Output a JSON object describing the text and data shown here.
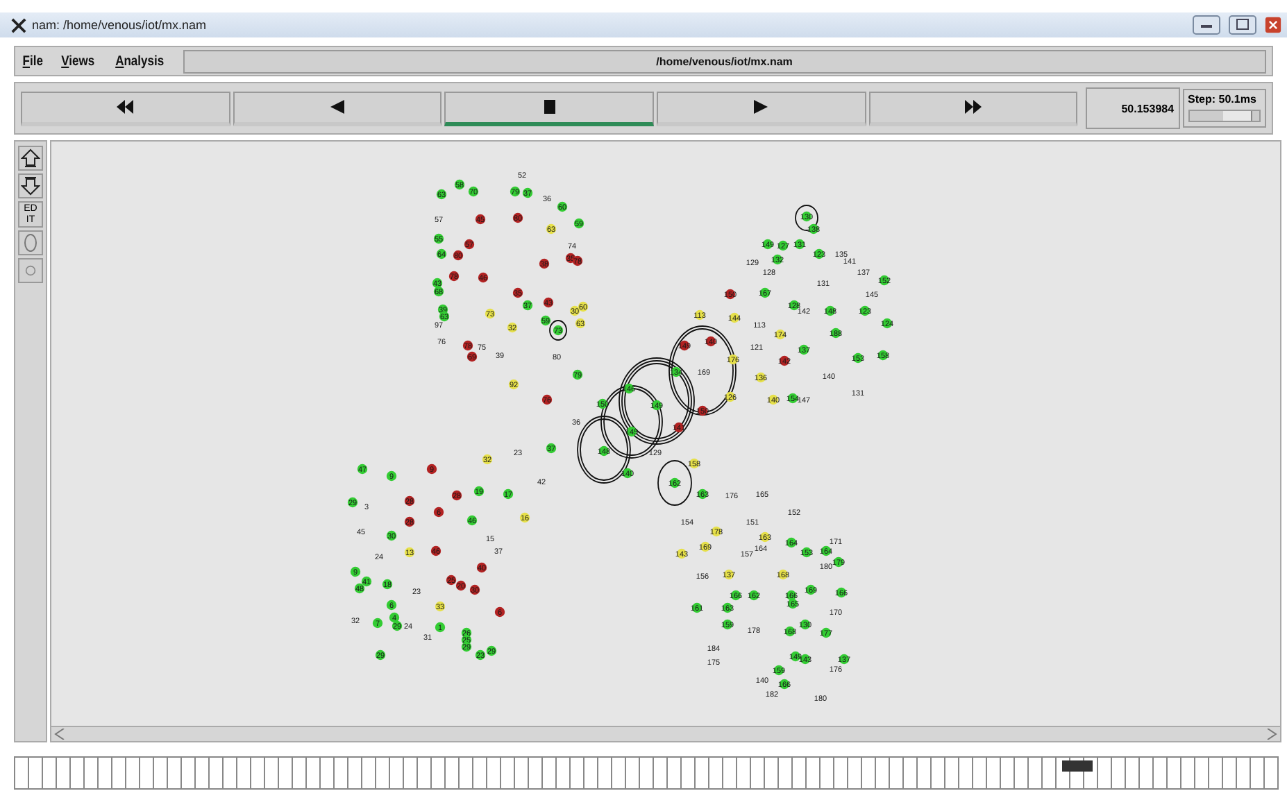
{
  "window": {
    "title": "nam: /home/venous/iot/mx.nam"
  },
  "menu": [
    {
      "label": "File"
    },
    {
      "label": "Views"
    },
    {
      "label": "Analysis"
    }
  ],
  "file_path": "/home/venous/iot/mx.nam",
  "controls": [
    {
      "kind": "rewind",
      "selected": false
    },
    {
      "kind": "back",
      "selected": false
    },
    {
      "kind": "stop",
      "selected": true
    },
    {
      "kind": "play",
      "selected": false
    },
    {
      "kind": "fastforward",
      "selected": false
    }
  ],
  "time": "50.153984",
  "step": {
    "label": "Step: 50.1ms",
    "level": 0.9
  },
  "tools": [
    {
      "kind": "zoom-in"
    },
    {
      "kind": "zoom-out"
    },
    {
      "kind": "edit",
      "label": "ED IT"
    },
    {
      "kind": "circle"
    },
    {
      "kind": "dot"
    }
  ],
  "nodes": [
    {
      "label": "52"
    },
    {
      "label": "58",
      "color": "#33cc33"
    },
    {
      "label": "70",
      "color": "#33cc33"
    },
    {
      "label": "63",
      "color": "#33cc33"
    },
    {
      "label": "79",
      "color": "#33cc33"
    },
    {
      "label": "37",
      "color": "#33cc33"
    },
    {
      "label": "36"
    },
    {
      "label": "60",
      "color": "#33cc33"
    },
    {
      "label": "57"
    },
    {
      "label": "45",
      "color": "#b22222"
    },
    {
      "label": "80",
      "color": "#b22222"
    },
    {
      "label": "63",
      "color": "#e6e04a"
    },
    {
      "label": "59",
      "color": "#33cc33"
    },
    {
      "label": "55",
      "color": "#33cc33"
    },
    {
      "label": "57",
      "color": "#b22222"
    },
    {
      "label": "74"
    },
    {
      "label": "64",
      "color": "#33cc33"
    },
    {
      "label": "80",
      "color": "#b22222"
    },
    {
      "label": "35",
      "color": "#b22222"
    },
    {
      "label": "78",
      "color": "#b22222"
    },
    {
      "label": "38",
      "color": "#b22222"
    },
    {
      "label": "78",
      "color": "#b22222"
    },
    {
      "label": "46",
      "color": "#b22222"
    },
    {
      "label": "43",
      "color": "#33cc33"
    },
    {
      "label": "68",
      "color": "#33cc33"
    },
    {
      "label": "35",
      "color": "#b22222"
    },
    {
      "label": "37",
      "color": "#33cc33"
    },
    {
      "label": "43",
      "color": "#b22222"
    },
    {
      "label": "39",
      "color": "#33cc33"
    },
    {
      "label": "63",
      "color": "#33cc33"
    },
    {
      "label": "73",
      "color": "#e6e04a"
    },
    {
      "label": "30",
      "color": "#e6e04a"
    },
    {
      "label": "60",
      "color": "#e6e04a"
    },
    {
      "label": "97"
    },
    {
      "label": "59",
      "color": "#33cc33"
    },
    {
      "label": "32",
      "color": "#e6e04a"
    },
    {
      "label": "73",
      "color": "#33cc33"
    },
    {
      "label": "63",
      "color": "#e6e04a"
    },
    {
      "label": "76"
    },
    {
      "label": "78",
      "color": "#b22222"
    },
    {
      "label": "75"
    },
    {
      "label": "69",
      "color": "#b22222"
    },
    {
      "label": "39"
    },
    {
      "label": "80"
    },
    {
      "label": "79",
      "color": "#33cc33"
    },
    {
      "label": "92",
      "color": "#e6e04a"
    },
    {
      "label": "76",
      "color": "#b22222"
    },
    {
      "label": "36"
    },
    {
      "label": "37",
      "color": "#33cc33"
    },
    {
      "label": "23"
    },
    {
      "label": "32",
      "color": "#e6e04a"
    },
    {
      "label": "47",
      "color": "#33cc33"
    },
    {
      "label": "9",
      "color": "#33cc33"
    },
    {
      "label": "9",
      "color": "#b22222"
    },
    {
      "label": "42"
    },
    {
      "label": "29",
      "color": "#33cc33"
    },
    {
      "label": "3"
    },
    {
      "label": "28",
      "color": "#b22222"
    },
    {
      "label": "28",
      "color": "#b22222"
    },
    {
      "label": "19",
      "color": "#33cc33"
    },
    {
      "label": "17",
      "color": "#33cc33"
    },
    {
      "label": "28",
      "color": "#b22222"
    },
    {
      "label": "6",
      "color": "#b22222"
    },
    {
      "label": "46",
      "color": "#33cc33"
    },
    {
      "label": "16",
      "color": "#e6e04a"
    },
    {
      "label": "45"
    },
    {
      "label": "30",
      "color": "#33cc33"
    },
    {
      "label": "15"
    },
    {
      "label": "24"
    },
    {
      "label": "13",
      "color": "#e6e04a"
    },
    {
      "label": "46",
      "color": "#b22222"
    },
    {
      "label": "37"
    },
    {
      "label": "40",
      "color": "#b22222"
    },
    {
      "label": "9",
      "color": "#33cc33"
    },
    {
      "label": "41",
      "color": "#33cc33"
    },
    {
      "label": "48",
      "color": "#33cc33"
    },
    {
      "label": "18",
      "color": "#33cc33"
    },
    {
      "label": "23"
    },
    {
      "label": "25",
      "color": "#b22222"
    },
    {
      "label": "20",
      "color": "#b22222"
    },
    {
      "label": "30",
      "color": "#b22222"
    },
    {
      "label": "6",
      "color": "#33cc33"
    },
    {
      "label": "33",
      "color": "#e6e04a"
    },
    {
      "label": "6",
      "color": "#b22222"
    },
    {
      "label": "4",
      "color": "#33cc33"
    },
    {
      "label": "32"
    },
    {
      "label": "7",
      "color": "#33cc33"
    },
    {
      "label": "29",
      "color": "#33cc33"
    },
    {
      "label": "24"
    },
    {
      "label": "1",
      "color": "#33cc33"
    },
    {
      "label": "31"
    },
    {
      "label": "26",
      "color": "#33cc33"
    },
    {
      "label": "25",
      "color": "#33cc33"
    },
    {
      "label": "29",
      "color": "#33cc33"
    },
    {
      "label": "29",
      "color": "#33cc33"
    },
    {
      "label": "29",
      "color": "#33cc33"
    },
    {
      "label": "23",
      "color": "#33cc33"
    },
    {
      "label": "146",
      "color": "#33cc33"
    },
    {
      "label": "150",
      "color": "#33cc33"
    },
    {
      "label": "149",
      "color": "#33cc33"
    },
    {
      "label": "145",
      "color": "#33cc33"
    },
    {
      "label": "148",
      "color": "#33cc33"
    },
    {
      "label": "129"
    },
    {
      "label": "141",
      "color": "#b22222"
    },
    {
      "label": "140",
      "color": "#33cc33"
    },
    {
      "label": "158",
      "color": "#e6e04a"
    },
    {
      "label": "162",
      "color": "#33cc33"
    },
    {
      "label": "163",
      "color": "#33cc33"
    },
    {
      "label": "176"
    },
    {
      "label": "130",
      "color": "#33cc33"
    },
    {
      "label": "138",
      "color": "#33cc33"
    },
    {
      "label": "149",
      "color": "#33cc33"
    },
    {
      "label": "127",
      "color": "#33cc33"
    },
    {
      "label": "131",
      "color": "#33cc33"
    },
    {
      "label": "123",
      "color": "#33cc33"
    },
    {
      "label": "135"
    },
    {
      "label": "129"
    },
    {
      "label": "132",
      "color": "#33cc33"
    },
    {
      "label": "141"
    },
    {
      "label": "128"
    },
    {
      "label": "137"
    },
    {
      "label": "131"
    },
    {
      "label": "152",
      "color": "#33cc33"
    },
    {
      "label": "150",
      "color": "#b22222"
    },
    {
      "label": "167",
      "color": "#33cc33"
    },
    {
      "label": "145"
    },
    {
      "label": "113",
      "color": "#e6e04a"
    },
    {
      "label": "144",
      "color": "#e6e04a"
    },
    {
      "label": "128",
      "color": "#33cc33"
    },
    {
      "label": "142"
    },
    {
      "label": "148",
      "color": "#33cc33"
    },
    {
      "label": "123",
      "color": "#33cc33"
    },
    {
      "label": "113"
    },
    {
      "label": "124",
      "color": "#33cc33"
    },
    {
      "label": "174",
      "color": "#e6e04a"
    },
    {
      "label": "188",
      "color": "#33cc33"
    },
    {
      "label": "149",
      "color": "#b22222"
    },
    {
      "label": "140",
      "color": "#b22222"
    },
    {
      "label": "121"
    },
    {
      "label": "137",
      "color": "#33cc33"
    },
    {
      "label": "176",
      "color": "#e6e04a"
    },
    {
      "label": "142",
      "color": "#b22222"
    },
    {
      "label": "153",
      "color": "#33cc33"
    },
    {
      "label": "158",
      "color": "#33cc33"
    },
    {
      "label": "134",
      "color": "#33cc33"
    },
    {
      "label": "169"
    },
    {
      "label": "136",
      "color": "#e6e04a"
    },
    {
      "label": "140"
    },
    {
      "label": "126",
      "color": "#e6e04a"
    },
    {
      "label": "140",
      "color": "#e6e04a"
    },
    {
      "label": "154",
      "color": "#33cc33"
    },
    {
      "label": "147"
    },
    {
      "label": "131"
    },
    {
      "label": "150",
      "color": "#b22222"
    },
    {
      "label": "165"
    },
    {
      "label": "152"
    },
    {
      "label": "154"
    },
    {
      "label": "151"
    },
    {
      "label": "178",
      "color": "#e6e04a"
    },
    {
      "label": "163",
      "color": "#e6e04a"
    },
    {
      "label": "169",
      "color": "#e6e04a"
    },
    {
      "label": "164"
    },
    {
      "label": "164",
      "color": "#33cc33"
    },
    {
      "label": "171"
    },
    {
      "label": "143",
      "color": "#e6e04a"
    },
    {
      "label": "157"
    },
    {
      "label": "153",
      "color": "#33cc33"
    },
    {
      "label": "164",
      "color": "#33cc33"
    },
    {
      "label": "180"
    },
    {
      "label": "179",
      "color": "#33cc33"
    },
    {
      "label": "156"
    },
    {
      "label": "137",
      "color": "#e6e04a"
    },
    {
      "label": "168",
      "color": "#e6e04a"
    },
    {
      "label": "166",
      "color": "#33cc33"
    },
    {
      "label": "162",
      "color": "#33cc33"
    },
    {
      "label": "166",
      "color": "#33cc33"
    },
    {
      "label": "169",
      "color": "#33cc33"
    },
    {
      "label": "166",
      "color": "#33cc33"
    },
    {
      "label": "161",
      "color": "#33cc33"
    },
    {
      "label": "163",
      "color": "#33cc33"
    },
    {
      "label": "165",
      "color": "#33cc33"
    },
    {
      "label": "170"
    },
    {
      "label": "159",
      "color": "#33cc33"
    },
    {
      "label": "178"
    },
    {
      "label": "168",
      "color": "#33cc33"
    },
    {
      "label": "130",
      "color": "#33cc33"
    },
    {
      "label": "177",
      "color": "#33cc33"
    },
    {
      "label": "184"
    },
    {
      "label": "175"
    },
    {
      "label": "149",
      "color": "#33cc33"
    },
    {
      "label": "143",
      "color": "#33cc33"
    },
    {
      "label": "137",
      "color": "#33cc33"
    },
    {
      "label": "159",
      "color": "#33cc33"
    },
    {
      "label": "176"
    },
    {
      "label": "140"
    },
    {
      "label": "166",
      "color": "#33cc33"
    },
    {
      "label": "182"
    },
    {
      "label": "180"
    }
  ],
  "timeline": {
    "level": 0.83
  }
}
